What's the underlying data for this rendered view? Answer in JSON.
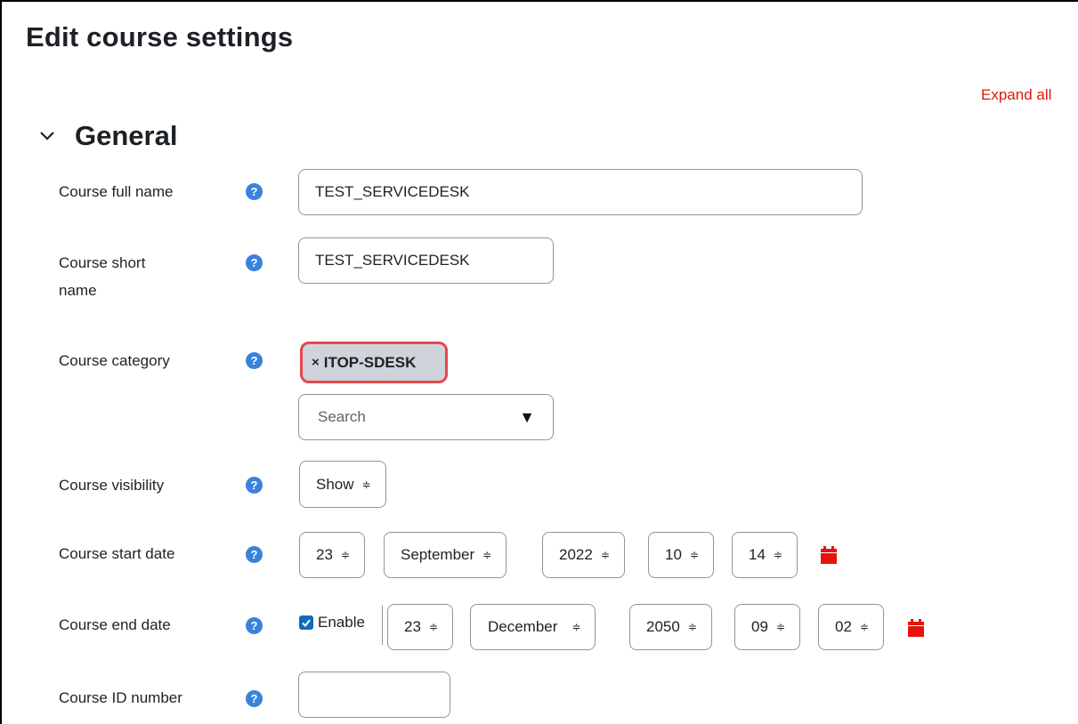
{
  "page_title": "Edit course settings",
  "expand_all": "Expand all",
  "section": {
    "title": "General"
  },
  "help_glyph": "?",
  "fields": {
    "full_name": {
      "label": "Course full name",
      "value": "TEST_SERVICEDESK"
    },
    "short_name": {
      "label_line1": "Course short",
      "label_line2": "name",
      "value": "TEST_SERVICEDESK"
    },
    "category": {
      "label": "Course category",
      "chip_x": "×",
      "chip_text": "ITOP-SDESK",
      "search_placeholder": "Search",
      "caret": "▼"
    },
    "visibility": {
      "label": "Course visibility",
      "value": "Show"
    },
    "start_date": {
      "label": "Course start date",
      "day": "23",
      "month": "September",
      "year": "2022",
      "hour": "10",
      "minute": "14"
    },
    "end_date": {
      "label": "Course end date",
      "enable_label": "Enable",
      "enabled": true,
      "day": "23",
      "month": "December",
      "year": "2050",
      "hour": "09",
      "minute": "02"
    },
    "id_number": {
      "label": "Course ID number",
      "value": ""
    }
  },
  "select_arrows": "≑",
  "colors": {
    "accent_red": "#e5130c",
    "help_blue": "#3b82dd",
    "checkbox_blue": "#0f6cbf",
    "chip_border": "#e5484d",
    "chip_bg": "#ced4da"
  }
}
